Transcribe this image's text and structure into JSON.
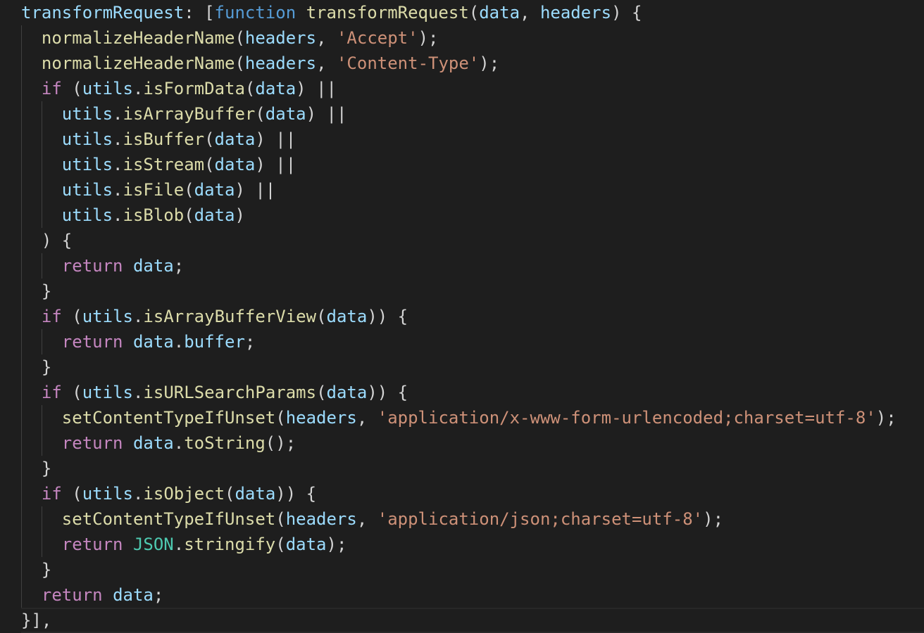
{
  "editor": {
    "language": "javascript",
    "lines": [
      {
        "indent": 0,
        "tokens": [
          {
            "t": "transformRequest",
            "c": "prop"
          },
          {
            "t": ": [",
            "c": "punc"
          },
          {
            "t": "function",
            "c": "kw"
          },
          {
            "t": " ",
            "c": "punc"
          },
          {
            "t": "transformRequest",
            "c": "fn"
          },
          {
            "t": "(",
            "c": "punc"
          },
          {
            "t": "data",
            "c": "param"
          },
          {
            "t": ", ",
            "c": "punc"
          },
          {
            "t": "headers",
            "c": "param"
          },
          {
            "t": ") {",
            "c": "punc"
          }
        ]
      },
      {
        "indent": 1,
        "tokens": [
          {
            "t": "normalizeHeaderName",
            "c": "fn"
          },
          {
            "t": "(",
            "c": "punc"
          },
          {
            "t": "headers",
            "c": "var"
          },
          {
            "t": ", ",
            "c": "punc"
          },
          {
            "t": "'Accept'",
            "c": "str"
          },
          {
            "t": ");",
            "c": "punc"
          }
        ]
      },
      {
        "indent": 1,
        "tokens": [
          {
            "t": "normalizeHeaderName",
            "c": "fn"
          },
          {
            "t": "(",
            "c": "punc"
          },
          {
            "t": "headers",
            "c": "var"
          },
          {
            "t": ", ",
            "c": "punc"
          },
          {
            "t": "'Content-Type'",
            "c": "str"
          },
          {
            "t": ");",
            "c": "punc"
          }
        ]
      },
      {
        "indent": 1,
        "tokens": [
          {
            "t": "if",
            "c": "ctrl"
          },
          {
            "t": " (",
            "c": "punc"
          },
          {
            "t": "utils",
            "c": "var"
          },
          {
            "t": ".",
            "c": "punc"
          },
          {
            "t": "isFormData",
            "c": "fn"
          },
          {
            "t": "(",
            "c": "punc"
          },
          {
            "t": "data",
            "c": "var"
          },
          {
            "t": ") ||",
            "c": "punc"
          }
        ]
      },
      {
        "indent": 2,
        "tokens": [
          {
            "t": "utils",
            "c": "var"
          },
          {
            "t": ".",
            "c": "punc"
          },
          {
            "t": "isArrayBuffer",
            "c": "fn"
          },
          {
            "t": "(",
            "c": "punc"
          },
          {
            "t": "data",
            "c": "var"
          },
          {
            "t": ") ||",
            "c": "punc"
          }
        ]
      },
      {
        "indent": 2,
        "tokens": [
          {
            "t": "utils",
            "c": "var"
          },
          {
            "t": ".",
            "c": "punc"
          },
          {
            "t": "isBuffer",
            "c": "fn"
          },
          {
            "t": "(",
            "c": "punc"
          },
          {
            "t": "data",
            "c": "var"
          },
          {
            "t": ") ||",
            "c": "punc"
          }
        ]
      },
      {
        "indent": 2,
        "tokens": [
          {
            "t": "utils",
            "c": "var"
          },
          {
            "t": ".",
            "c": "punc"
          },
          {
            "t": "isStream",
            "c": "fn"
          },
          {
            "t": "(",
            "c": "punc"
          },
          {
            "t": "data",
            "c": "var"
          },
          {
            "t": ") ||",
            "c": "punc"
          }
        ]
      },
      {
        "indent": 2,
        "tokens": [
          {
            "t": "utils",
            "c": "var"
          },
          {
            "t": ".",
            "c": "punc"
          },
          {
            "t": "isFile",
            "c": "fn"
          },
          {
            "t": "(",
            "c": "punc"
          },
          {
            "t": "data",
            "c": "var"
          },
          {
            "t": ") ||",
            "c": "punc"
          }
        ]
      },
      {
        "indent": 2,
        "tokens": [
          {
            "t": "utils",
            "c": "var"
          },
          {
            "t": ".",
            "c": "punc"
          },
          {
            "t": "isBlob",
            "c": "fn"
          },
          {
            "t": "(",
            "c": "punc"
          },
          {
            "t": "data",
            "c": "var"
          },
          {
            "t": ")",
            "c": "punc"
          }
        ]
      },
      {
        "indent": 1,
        "tokens": [
          {
            "t": ") {",
            "c": "punc"
          }
        ]
      },
      {
        "indent": 2,
        "tokens": [
          {
            "t": "return",
            "c": "ctrl"
          },
          {
            "t": " ",
            "c": "punc"
          },
          {
            "t": "data",
            "c": "var"
          },
          {
            "t": ";",
            "c": "punc"
          }
        ]
      },
      {
        "indent": 1,
        "tokens": [
          {
            "t": "}",
            "c": "punc"
          }
        ]
      },
      {
        "indent": 1,
        "tokens": [
          {
            "t": "if",
            "c": "ctrl"
          },
          {
            "t": " (",
            "c": "punc"
          },
          {
            "t": "utils",
            "c": "var"
          },
          {
            "t": ".",
            "c": "punc"
          },
          {
            "t": "isArrayBufferView",
            "c": "fn"
          },
          {
            "t": "(",
            "c": "punc"
          },
          {
            "t": "data",
            "c": "var"
          },
          {
            "t": ")) {",
            "c": "punc"
          }
        ]
      },
      {
        "indent": 2,
        "tokens": [
          {
            "t": "return",
            "c": "ctrl"
          },
          {
            "t": " ",
            "c": "punc"
          },
          {
            "t": "data",
            "c": "var"
          },
          {
            "t": ".",
            "c": "punc"
          },
          {
            "t": "buffer",
            "c": "var"
          },
          {
            "t": ";",
            "c": "punc"
          }
        ]
      },
      {
        "indent": 1,
        "tokens": [
          {
            "t": "}",
            "c": "punc"
          }
        ]
      },
      {
        "indent": 1,
        "tokens": [
          {
            "t": "if",
            "c": "ctrl"
          },
          {
            "t": " (",
            "c": "punc"
          },
          {
            "t": "utils",
            "c": "var"
          },
          {
            "t": ".",
            "c": "punc"
          },
          {
            "t": "isURLSearchParams",
            "c": "fn"
          },
          {
            "t": "(",
            "c": "punc"
          },
          {
            "t": "data",
            "c": "var"
          },
          {
            "t": ")) {",
            "c": "punc"
          }
        ]
      },
      {
        "indent": 2,
        "tokens": [
          {
            "t": "setContentTypeIfUnset",
            "c": "fn"
          },
          {
            "t": "(",
            "c": "punc"
          },
          {
            "t": "headers",
            "c": "var"
          },
          {
            "t": ", ",
            "c": "punc"
          },
          {
            "t": "'application/x-www-form-urlencoded;charset=utf-8'",
            "c": "str"
          },
          {
            "t": ");",
            "c": "punc"
          }
        ]
      },
      {
        "indent": 2,
        "tokens": [
          {
            "t": "return",
            "c": "ctrl"
          },
          {
            "t": " ",
            "c": "punc"
          },
          {
            "t": "data",
            "c": "var"
          },
          {
            "t": ".",
            "c": "punc"
          },
          {
            "t": "toString",
            "c": "fn"
          },
          {
            "t": "();",
            "c": "punc"
          }
        ]
      },
      {
        "indent": 1,
        "tokens": [
          {
            "t": "}",
            "c": "punc"
          }
        ]
      },
      {
        "indent": 1,
        "tokens": [
          {
            "t": "if",
            "c": "ctrl"
          },
          {
            "t": " (",
            "c": "punc"
          },
          {
            "t": "utils",
            "c": "var"
          },
          {
            "t": ".",
            "c": "punc"
          },
          {
            "t": "isObject",
            "c": "fn"
          },
          {
            "t": "(",
            "c": "punc"
          },
          {
            "t": "data",
            "c": "var"
          },
          {
            "t": ")) {",
            "c": "punc"
          }
        ]
      },
      {
        "indent": 2,
        "tokens": [
          {
            "t": "setContentTypeIfUnset",
            "c": "fn"
          },
          {
            "t": "(",
            "c": "punc"
          },
          {
            "t": "headers",
            "c": "var"
          },
          {
            "t": ", ",
            "c": "punc"
          },
          {
            "t": "'application/json;charset=utf-8'",
            "c": "str"
          },
          {
            "t": ");",
            "c": "punc"
          }
        ]
      },
      {
        "indent": 2,
        "tokens": [
          {
            "t": "return",
            "c": "ctrl"
          },
          {
            "t": " ",
            "c": "punc"
          },
          {
            "t": "JSON",
            "c": "const"
          },
          {
            "t": ".",
            "c": "punc"
          },
          {
            "t": "stringify",
            "c": "fn"
          },
          {
            "t": "(",
            "c": "punc"
          },
          {
            "t": "data",
            "c": "var"
          },
          {
            "t": ");",
            "c": "punc"
          }
        ]
      },
      {
        "indent": 1,
        "tokens": [
          {
            "t": "}",
            "c": "punc"
          }
        ]
      },
      {
        "indent": 1,
        "tokens": [
          {
            "t": "return",
            "c": "ctrl"
          },
          {
            "t": " ",
            "c": "punc"
          },
          {
            "t": "data",
            "c": "var"
          },
          {
            "t": ";",
            "c": "punc"
          }
        ]
      },
      {
        "indent": 0,
        "tokens": [
          {
            "t": "}],",
            "c": "punc"
          }
        ]
      }
    ]
  }
}
